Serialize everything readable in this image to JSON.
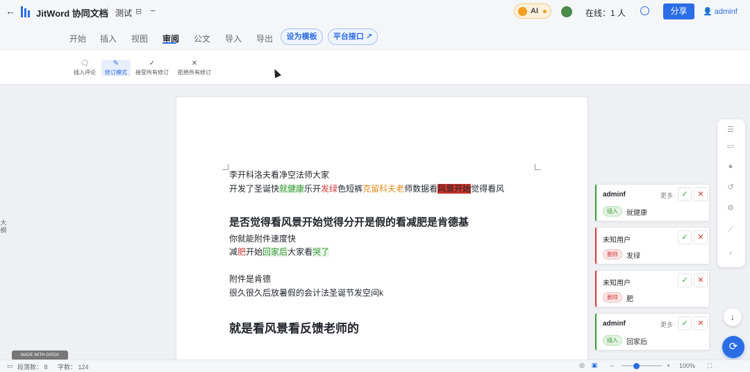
{
  "header": {
    "app_title": "JitWord 协同文档",
    "doc_title": "测试",
    "ai_label": "AI",
    "online_text": "在线：1 人",
    "share_label": "分享",
    "user_label": "adminf"
  },
  "menu": {
    "tabs": [
      "开始",
      "插入",
      "视图",
      "审阅",
      "公文",
      "导入",
      "导出"
    ],
    "active_tab": "审阅",
    "template_button": "设为模板",
    "platform_button": "平台接口 ↗"
  },
  "toolbar": {
    "insert_comment": "插入评论",
    "revision_mode": "修订模式",
    "accept_all": "接受所有修订",
    "reject_all": "拒绝所有修订"
  },
  "outline_label": "大纲",
  "document": {
    "p1": "李开科洛夫看净空法师大家",
    "p2_parts": [
      "开发了圣诞快",
      "就健康",
      "乐开",
      "发绿",
      "色短裤",
      "克留科夫老",
      "师数据看",
      "风景开始",
      "觉得看风"
    ],
    "h2": "是否觉得看风景开始觉得分开是假的看减肥是肯德基",
    "p3": "你就能附件速度快",
    "p4_parts": [
      "减",
      "肥",
      "开始",
      "回家后",
      "大家看",
      "哭了"
    ],
    "p5": "附件是肯德",
    "p6": "很久很久后放暑假的会计法圣诞节发空间k",
    "h1": "就是看风景看反馈老师的"
  },
  "comments": [
    {
      "user": "adminf",
      "more": "更多",
      "tag": "插入",
      "text": "就健康",
      "type": "insert"
    },
    {
      "user": "未知用户",
      "more": "",
      "tag": "删除",
      "text": "发绿",
      "type": "delete"
    },
    {
      "user": "未知用户",
      "more": "",
      "tag": "删除",
      "text": "肥",
      "type": "delete"
    },
    {
      "user": "adminf",
      "more": "更多",
      "tag": "插入",
      "text": "回家后",
      "type": "insert"
    }
  ],
  "gif_badge": "MADE WITH GIFOX",
  "status": {
    "para_label": "段落数：",
    "para_count": "8",
    "word_label": "字数：",
    "word_count": "124",
    "zoom": "100%"
  },
  "colors": {
    "accent": "#2b6de5",
    "insert": "#3a9a3a",
    "delete": "#d03b3b"
  }
}
